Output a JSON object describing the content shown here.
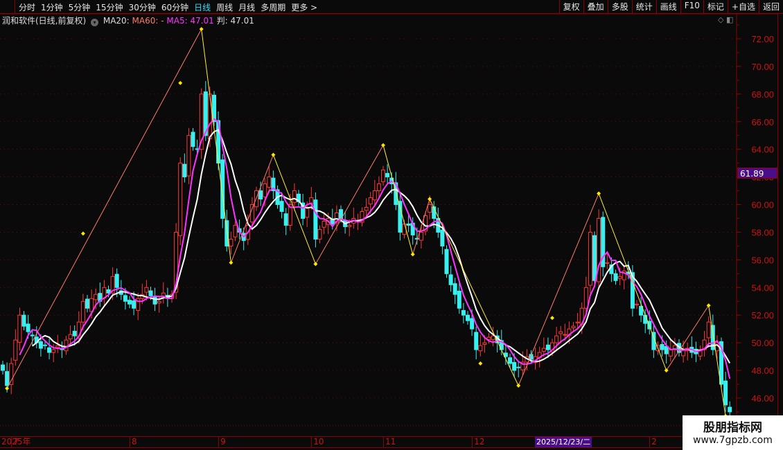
{
  "toolbar": {
    "periods": [
      "分时",
      "1分钟",
      "5分钟",
      "15分钟",
      "30分钟",
      "60分钟",
      "日线",
      "周线",
      "月线",
      "多周期",
      "更多 >"
    ],
    "active_period": "日线",
    "right_buttons": [
      "复权",
      "叠加",
      "多股",
      "统计",
      "画线",
      "F10",
      "标记",
      "+自选",
      "返回"
    ]
  },
  "info": {
    "title": "润和软件(日线,前复权)",
    "ma20_label": "MA20:",
    "ma60_label": "MA60: -",
    "ma5_label": "MA5: 47.01",
    "judge_label": "判: 47.01"
  },
  "price_tag": "61.89",
  "watermark": {
    "line1": "股朋指标网",
    "line2": "www.7gpzb.com"
  },
  "colors": {
    "up": "#ff3838",
    "down": "#38f0f0",
    "ma5": "#ff33ff",
    "ma_white": "#ffffff",
    "zig_up": "#ff7a6a",
    "zig_down": "#ffee33",
    "axis": "#cc1111"
  },
  "chart_data": {
    "type": "candlestick",
    "title": "润和软件 日线",
    "ylim": [
      44.5,
      73.2
    ],
    "y_ticks": [
      "72.00",
      "70.00",
      "68.00",
      "66.00",
      "64.00",
      "62.00",
      "60.00",
      "58.00",
      "56.00",
      "54.00",
      "52.00",
      "50.00",
      "48.00",
      "46.00"
    ],
    "x_labels": [
      {
        "label": "2025年",
        "index": -1
      },
      {
        "label": "7",
        "index": 2
      },
      {
        "label": "8",
        "index": 30
      },
      {
        "label": "9",
        "index": 51
      },
      {
        "label": "10",
        "index": 73
      },
      {
        "label": "11",
        "index": 90
      },
      {
        "label": "12",
        "index": 111
      },
      {
        "label": "2",
        "index": 153
      }
    ],
    "cursor_label": "2025/12/23/二",
    "close": [
      48.0,
      46.9,
      48.5,
      50.2,
      52.0,
      51.2,
      50.8,
      50.5,
      50.0,
      49.6,
      49.8,
      49.3,
      49.5,
      49.8,
      49.5,
      50.2,
      50.6,
      50.5,
      51.5,
      53.0,
      52.5,
      53.2,
      53.5,
      53.0,
      54.0,
      53.6,
      54.8,
      54.0,
      53.5,
      53.0,
      52.8,
      52.5,
      53.2,
      53.5,
      54.0,
      53.4,
      52.8,
      53.0,
      53.6,
      53.2,
      53.5,
      58.0,
      63.0,
      62.0,
      65.0,
      64.2,
      64.0,
      68.0,
      65.0,
      68.0,
      66.0,
      63.0,
      59.0,
      57.0,
      57.5,
      58.5,
      58.0,
      57.4,
      58.5,
      60.0,
      61.0,
      60.4,
      61.5,
      62.0,
      61.0,
      60.0,
      59.5,
      58.5,
      60.0,
      61.0,
      60.2,
      59.0,
      59.8,
      60.5,
      57.5,
      58.2,
      58.8,
      59.0,
      58.6,
      59.4,
      59.0,
      58.4,
      58.5,
      59.0,
      58.8,
      59.5,
      59.8,
      60.5,
      61.0,
      61.5,
      62.5,
      62.0,
      61.5,
      60.0,
      58.0,
      58.6,
      58.5,
      57.8,
      57.5,
      58.0,
      59.2,
      60.0,
      59.0,
      58.0,
      57.0,
      55.0,
      54.2,
      53.5,
      52.5,
      52.0,
      51.6,
      51.0,
      49.5,
      49.8,
      50.0,
      50.4,
      50.5,
      50.0,
      49.5,
      49.0,
      48.5,
      48.0,
      48.2,
      48.6,
      49.0,
      48.8,
      49.0,
      49.3,
      49.6,
      49.5,
      50.0,
      50.5,
      50.8,
      50.6,
      51.0,
      51.2,
      51.5,
      52.5,
      54.0,
      58.0,
      54.5,
      59.0,
      55.5,
      55.8,
      55.0,
      54.5,
      54.8,
      55.2,
      55.0,
      52.5,
      52.8,
      52.0,
      51.4,
      51.0,
      49.5,
      49.8,
      49.5,
      49.2,
      49.5,
      49.8,
      49.3,
      49.5,
      49.6,
      49.3,
      49.2,
      49.5,
      50.2,
      51.5,
      49.5,
      50.0,
      47.0,
      45.5,
      45.0
    ],
    "ma_periods": {
      "ma5": 5,
      "ma_white": 8
    },
    "zigzag": [
      [
        1,
        46.7
      ],
      [
        47,
        72.7
      ],
      [
        54,
        55.8
      ],
      [
        64,
        63.6
      ],
      [
        74,
        55.7
      ],
      [
        90,
        64.3
      ],
      [
        97,
        56.4
      ],
      [
        101,
        60.4
      ],
      [
        122,
        46.9
      ],
      [
        141,
        60.8
      ],
      [
        157,
        48.0
      ],
      [
        167,
        52.7
      ],
      [
        171,
        44.7
      ]
    ],
    "marker_dots": [
      [
        19,
        57.9
      ],
      [
        42,
        68.8
      ],
      [
        113,
        48.5
      ],
      [
        130,
        51.8
      ]
    ]
  }
}
